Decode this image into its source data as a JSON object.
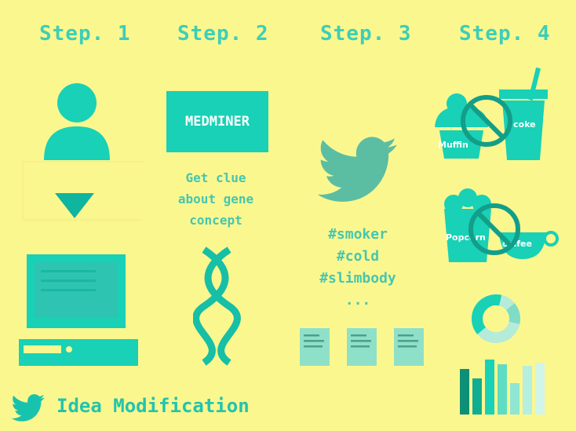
{
  "steps": {
    "step1": "Step. 1",
    "step2": "Step. 2",
    "step3": "Step. 3",
    "step4": "Step. 4"
  },
  "step2": {
    "logo_label": "MEDMINER",
    "clue_line1": "Get clue",
    "clue_line2": "about gene",
    "clue_line3": "concept"
  },
  "step3": {
    "hashtag1": "#smoker",
    "hashtag2": "#cold",
    "hashtag3": "#slimbody",
    "ellipsis": "..."
  },
  "step4": {
    "muffin_label": "Muffin",
    "coke_label": "coke",
    "popcorn_label": "Popcorn",
    "coffee_label": "coffee"
  },
  "footer": {
    "title": "Idea Modification"
  },
  "colors": {
    "background": "#fbf78f",
    "teal": "#18d1b6",
    "teal_dark": "#0e9f87",
    "twitter": "#5bbea3",
    "note": "#8fe0c8"
  }
}
